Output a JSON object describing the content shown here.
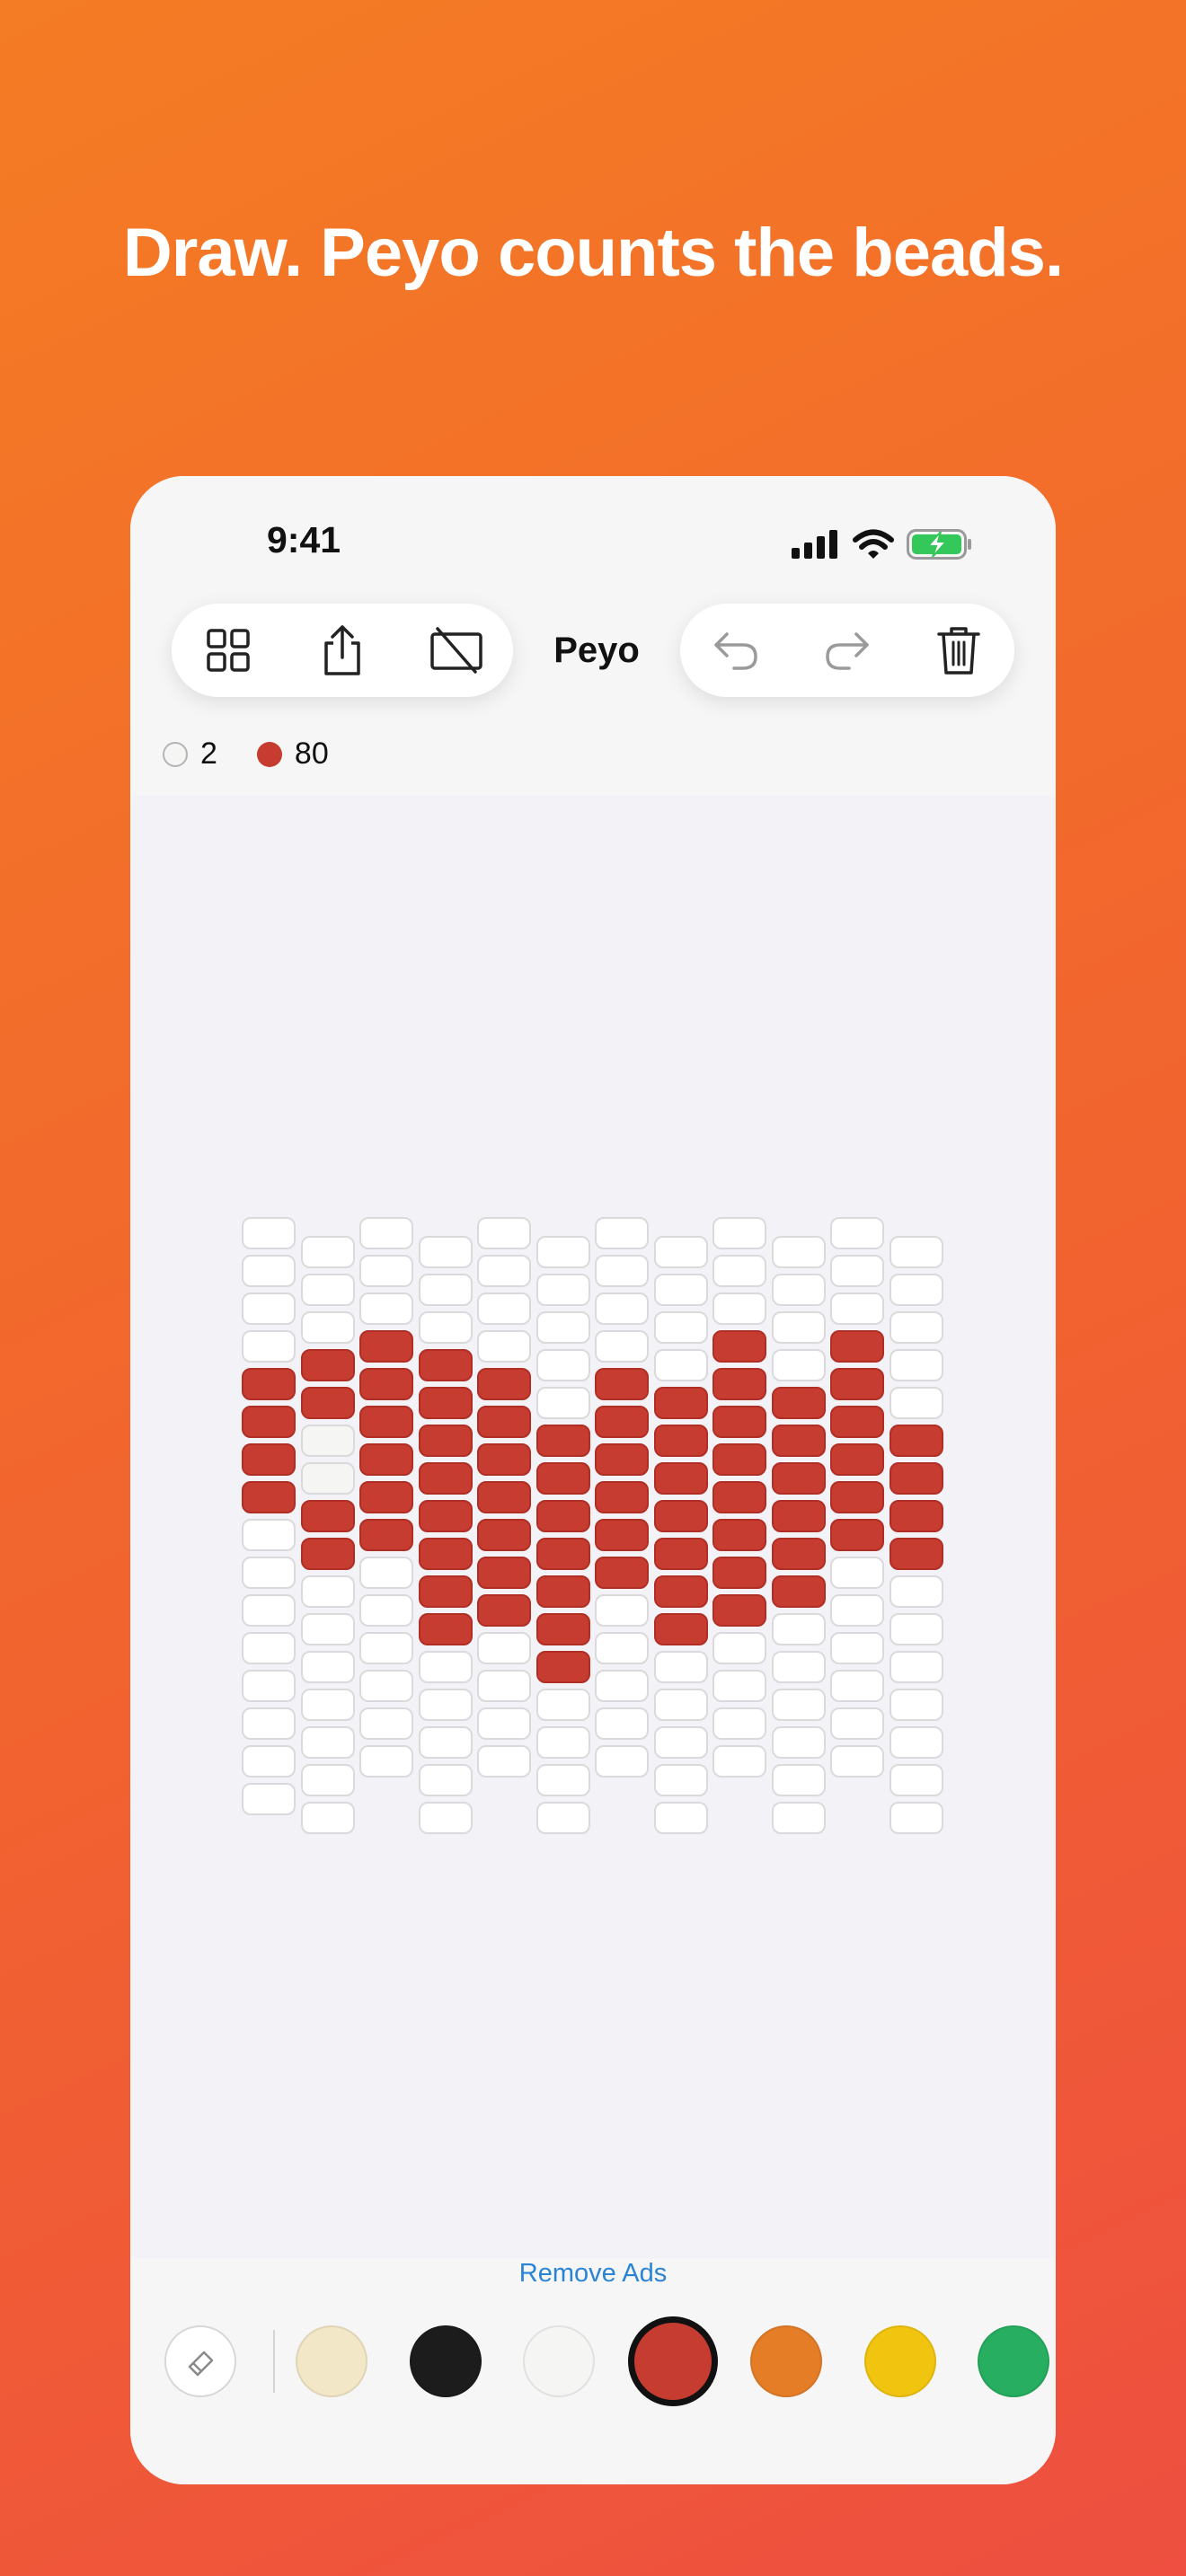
{
  "headline": "Draw. Peyo counts the beads.",
  "status_bar": {
    "time": "9:41"
  },
  "toolbar": {
    "title": "Peyo"
  },
  "bead_counts": [
    {
      "label": "2",
      "color": "#f5f5f3"
    },
    {
      "label": "80",
      "color": "#c63c31"
    }
  ],
  "grid": {
    "columns": 12,
    "rows": [
      16,
      16,
      15,
      16,
      15,
      16,
      15,
      16,
      15,
      16,
      15,
      16
    ],
    "pattern": [
      "eeeerrrreeeeeeee",
      "eeerrwwrreeeeeee",
      "eeerrrrrreeeeee",
      "eeerrrrrrrreeeee",
      "eeeerrrrrrreeee",
      "eeeeerrrrrrreeee",
      "eeeerrrrrreeeee",
      "eeeerrrrrrreeeee",
      "eeerrrrrrrreeee",
      "eeeerrrrrreeeeee",
      "eeerrrrrreeeeee",
      "eeeeerrrreeeeeee"
    ]
  },
  "bottom_bar": {
    "remove_ads": "Remove Ads",
    "palette": [
      {
        "name": "cream",
        "color": "#f2e7c6",
        "selected": false
      },
      {
        "name": "black",
        "color": "#1c1c1c",
        "selected": false
      },
      {
        "name": "white",
        "color": "#f5f5f3",
        "selected": false
      },
      {
        "name": "red",
        "color": "#c63c31",
        "selected": true
      },
      {
        "name": "orange",
        "color": "#e57d26",
        "selected": false
      },
      {
        "name": "yellow",
        "color": "#f1c40f",
        "selected": false
      },
      {
        "name": "green",
        "color": "#27ae60",
        "selected": false
      }
    ]
  },
  "icons": {
    "toolbar_left": [
      "grid-icon",
      "share-icon",
      "hide-grid-icon"
    ],
    "toolbar_right": [
      "undo-icon",
      "redo-icon",
      "trash-icon"
    ],
    "palette": "eraser-icon"
  }
}
